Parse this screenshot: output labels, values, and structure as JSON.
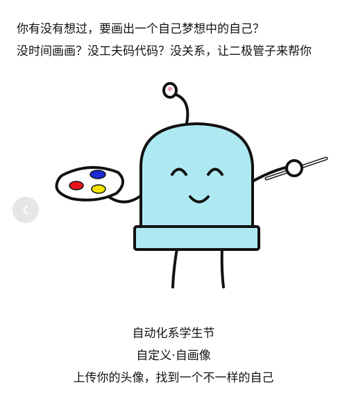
{
  "intro": {
    "line1": "你有没有想过，要画出一个自己梦想中的自己？",
    "line2": "没时间画画？没工夫码代码？没关系，让二极管子来帮你"
  },
  "illustration": {
    "body_color": "#aee9f2",
    "outline_color": "#111111",
    "antenna_tip_color": "#f2a0b0",
    "paint_colors": [
      "#e8141c",
      "#1c2ad6",
      "#f2e600"
    ]
  },
  "carousel": {
    "prev_icon": "chevron-left-icon",
    "button_color": "#e6e6e6"
  },
  "caption": {
    "line1": "自动化系学生节",
    "line2": "自定义·自画像",
    "line3": "上传你的头像，找到一个不一样的自己"
  }
}
